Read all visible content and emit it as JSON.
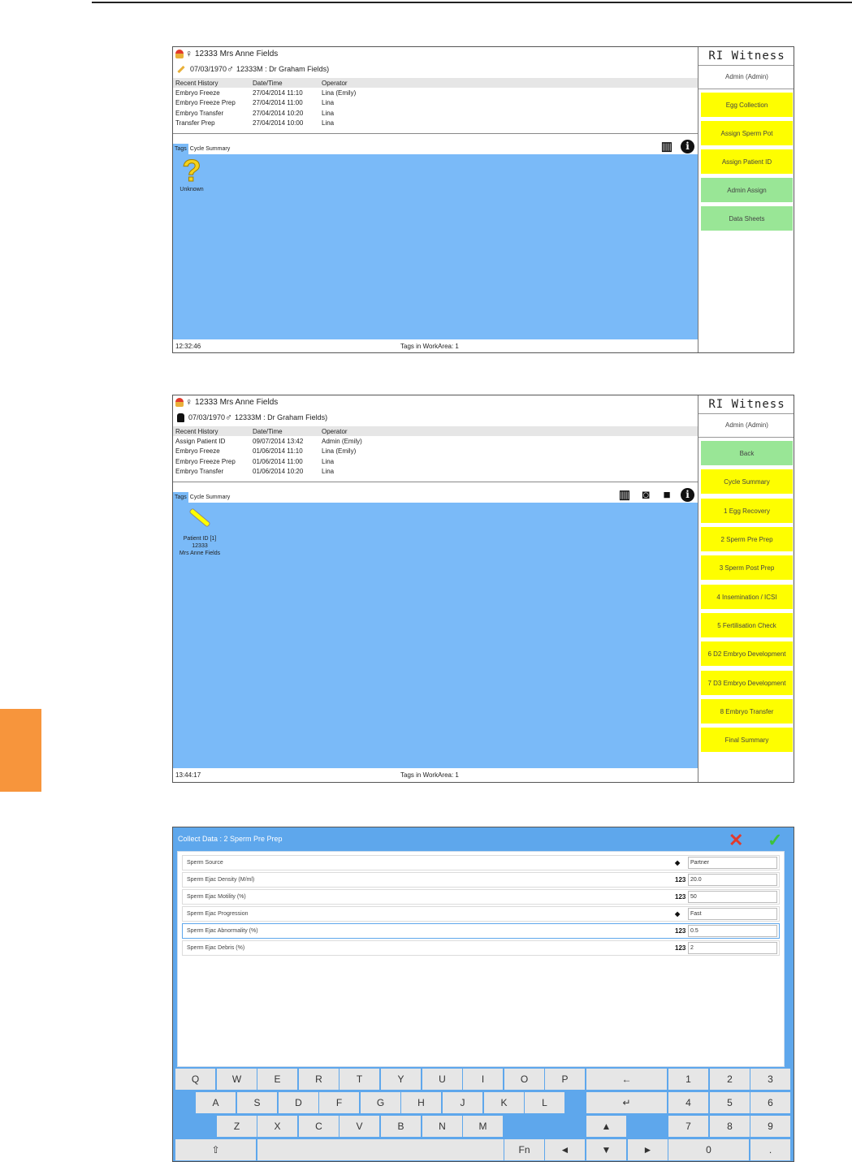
{
  "screens": {
    "s1": {
      "patient": "12333 Mrs Anne Fields",
      "dob_line": "07/03/1970 ",
      "partner": "12333M : Dr Graham Fields)",
      "history_headers": [
        "Recent History",
        "Date/Time",
        "Operator"
      ],
      "history": [
        [
          "Embryo Freeze",
          "27/04/2014 11:10",
          "Lina (Emily)"
        ],
        [
          "Embryo Freeze Prep",
          "27/04/2014 11:00",
          "Lina"
        ],
        [
          "Embryo Transfer",
          "27/04/2014 10:20",
          "Lina"
        ],
        [
          "Transfer Prep",
          "27/04/2014 10:00",
          "Lina"
        ]
      ],
      "tabs": [
        "Tags",
        "Cycle Summary"
      ],
      "tag_label": "Unknown",
      "time": "12:32:46",
      "tags_in_workarea": "Tags in WorkArea: 1",
      "brand": "RI Witness",
      "user": "Admin (Admin)",
      "buttons": [
        "Egg Collection",
        "Assign Sperm Pot",
        "Assign Patient ID",
        "Admin Assign",
        "Data Sheets"
      ]
    },
    "s2": {
      "patient": "12333 Mrs Anne Fields",
      "dob_line": "07/03/1970 ",
      "partner": "12333M : Dr Graham Fields)",
      "history_headers": [
        "Recent History",
        "Date/Time",
        "Operator"
      ],
      "history": [
        [
          "Assign Patient ID",
          "09/07/2014 13:42",
          "Admin (Emily)"
        ],
        [
          "Embryo Freeze",
          "01/06/2014 11:10",
          "Lina (Emily)"
        ],
        [
          "Embryo Freeze Prep",
          "01/06/2014 11:00",
          "Lina"
        ],
        [
          "Embryo Transfer",
          "01/06/2014 10:20",
          "Lina"
        ]
      ],
      "tabs": [
        "Tags",
        "Cycle Summary"
      ],
      "tag_lines": [
        "Patient ID [1]",
        "12333",
        "Mrs Anne Fields"
      ],
      "time": "13:44:17",
      "tags_in_workarea": "Tags in WorkArea: 1",
      "brand": "RI Witness",
      "user": "Admin (Admin)",
      "buttons": [
        "Back",
        "Cycle Summary",
        "1 Egg Recovery",
        "2 Sperm Pre Prep",
        "3 Sperm Post Prep",
        "4 Insemination / ICSI",
        "5 Fertilisation Check",
        "6 D2 Embryo Development",
        "7 D3 Embryo Development",
        "8 Embryo Transfer",
        "Final Summary"
      ]
    },
    "s3": {
      "title": "Collect Data : 2 Sperm Pre Prep",
      "fields": [
        {
          "label": "Sperm Source",
          "icon": "◆",
          "value": "Partner"
        },
        {
          "label": "Sperm Ejac Density (M/ml)",
          "icon": "123",
          "value": "20.0"
        },
        {
          "label": "Sperm Ejac Motility (%)",
          "icon": "123",
          "value": "50"
        },
        {
          "label": "Sperm Ejac Progression",
          "icon": "◆",
          "value": "Fast"
        },
        {
          "label": "Sperm Ejac Abnormality (%)",
          "icon": "123",
          "value": "0.5"
        },
        {
          "label": "Sperm Ejac Debris (%)",
          "icon": "123",
          "value": "2"
        }
      ],
      "keys": {
        "row1": [
          "Q",
          "W",
          "E",
          "R",
          "T",
          "Y",
          "U",
          "I",
          "O",
          "P",
          "←",
          "1",
          "2",
          "3"
        ],
        "row2": [
          "A",
          "S",
          "D",
          "F",
          "G",
          "H",
          "J",
          "K",
          "L",
          "↵",
          "4",
          "5",
          "6"
        ],
        "row3": [
          "Z",
          "X",
          "C",
          "V",
          "B",
          "N",
          "M",
          "▲",
          "7",
          "8",
          "9"
        ],
        "row4": [
          "⇧",
          "",
          "Fn",
          "◄",
          "▼",
          "►",
          "0",
          "."
        ]
      }
    }
  },
  "colors": {
    "workarea": "#7abaf8",
    "yellow": "#fefe00",
    "green": "#99e696",
    "accent": "#f7953c"
  }
}
